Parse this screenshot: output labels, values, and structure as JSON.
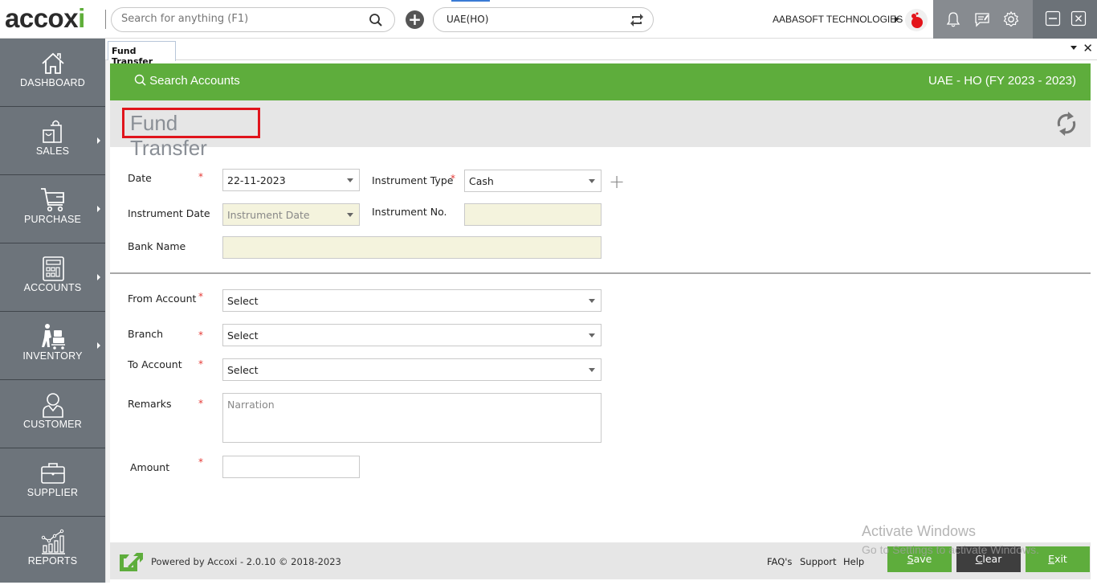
{
  "app": {
    "logo_text": "accoxi",
    "search_placeholder": "Search for anything (F1)",
    "branch_value": "UAE(HO)",
    "company_name": "AABASOFT TECHNOLOGIES",
    "icons": [
      "search-icon",
      "add-icon",
      "refresh-branch-icon",
      "bell-icon",
      "chat-icon",
      "gear-icon",
      "minimize-icon",
      "close-icon"
    ]
  },
  "sidebar": {
    "items": [
      {
        "label": "DASHBOARD",
        "icon": "home-icon",
        "has_submenu": false
      },
      {
        "label": "SALES",
        "icon": "shopping-bag-icon",
        "has_submenu": true
      },
      {
        "label": "PURCHASE",
        "icon": "cart-icon",
        "has_submenu": true
      },
      {
        "label": "ACCOUNTS",
        "icon": "calculator-icon",
        "has_submenu": true
      },
      {
        "label": "INVENTORY",
        "icon": "trolley-icon",
        "has_submenu": true
      },
      {
        "label": "CUSTOMER",
        "icon": "user-icon",
        "has_submenu": false
      },
      {
        "label": "SUPPLIER",
        "icon": "briefcase-icon",
        "has_submenu": false
      },
      {
        "label": "REPORTS",
        "icon": "chart-icon",
        "has_submenu": false
      }
    ]
  },
  "tabs": [
    {
      "label": "Fund Transfer",
      "active": true
    }
  ],
  "header": {
    "search_accounts": "Search Accounts",
    "fiscal_info": "UAE - HO (FY 2023 - 2023)",
    "page_title": "Fund Transfer"
  },
  "form": {
    "date": {
      "label": "Date",
      "value": "22-11-2023",
      "required": true
    },
    "instrument_type": {
      "label": "Instrument Type",
      "value": "Cash",
      "required": true
    },
    "instrument_date": {
      "label": "Instrument Date",
      "placeholder": "Instrument Date"
    },
    "instrument_no": {
      "label": "Instrument No.",
      "value": ""
    },
    "bank_name": {
      "label": "Bank Name",
      "value": ""
    },
    "from_account": {
      "label": "From Account",
      "value": "Select",
      "required": true
    },
    "branch": {
      "label": "Branch",
      "value": "Select",
      "required": true
    },
    "to_account": {
      "label": "To Account",
      "value": "Select",
      "required": true
    },
    "remarks": {
      "label": "Remarks",
      "placeholder": "Narration",
      "required": true
    },
    "amount": {
      "label": "Amount",
      "value": "",
      "required": true
    },
    "required_mark": "*"
  },
  "footer": {
    "powered_by": "Powered by Accoxi - 2.0.10 © 2018-2023",
    "links": [
      "FAQ's",
      "Support",
      "Help"
    ],
    "buttons": {
      "save": {
        "mnemonic": "S",
        "rest": "ave"
      },
      "clear": {
        "mnemonic": "C",
        "rest": "lear"
      },
      "exit": {
        "mnemonic": "E",
        "rest": "xit"
      }
    }
  },
  "watermark": {
    "line1": "Activate Windows",
    "line2": "Go to Settings to activate Windows."
  },
  "colors": {
    "brand_green": "#5ead3c",
    "sidebar_bg": "#6d747b",
    "highlight_red": "#e0141c",
    "disabled_field": "#f4f3dd"
  }
}
